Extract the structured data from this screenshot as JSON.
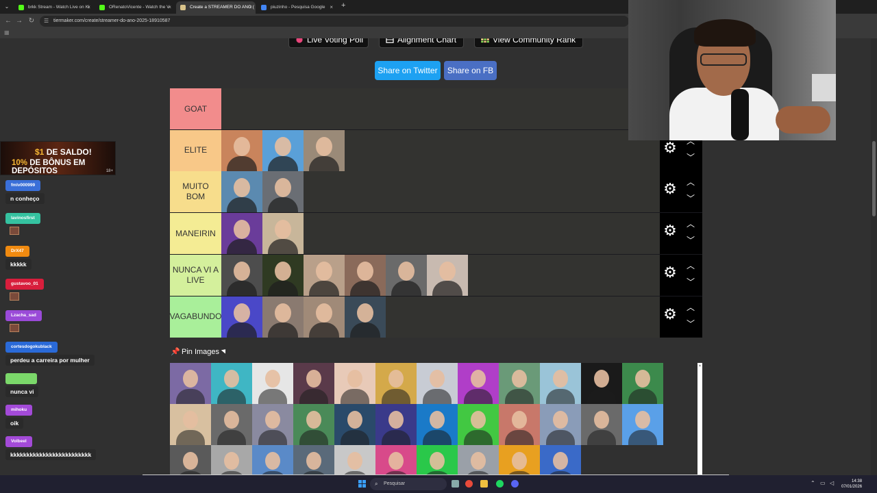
{
  "browser": {
    "tabs": [
      {
        "label": "brkk Stream - Watch Live on Ki",
        "icon_color": "#53fc18",
        "active": false
      },
      {
        "label": "ORenatoVicente - Watch the V",
        "icon_color": "#53fc18",
        "active": false
      },
      {
        "label": "Create a STREAMER DO ANO (",
        "icon_color": "#d9c38a",
        "active": true
      },
      {
        "label": "piuzinho - Pesquisa Google",
        "icon_color": "#4285f4",
        "active": false
      }
    ],
    "url": "tiermaker.com/create/streamer-do-ano-2025-18910587"
  },
  "toolbar": {
    "live_voting_label": "Live Voting Poll",
    "alignment_label": "Alignment Chart",
    "community_label": "View Community Rank",
    "share_twitter_label": "Share on Twitter",
    "share_fb_label": "Share on FB",
    "colors": {
      "twitter": "#1da1f2",
      "fb": "#4a6fc4"
    }
  },
  "tiers": [
    {
      "label": "GOAT",
      "color": "#f28c8c",
      "image_colors": []
    },
    {
      "label": "ELITE",
      "color": "#f8c888",
      "image_colors": [
        "#c9845c",
        "#5aa0d8",
        "#9a8a78"
      ]
    },
    {
      "label": "MUITO BOM",
      "color": "#f7dd8c",
      "image_colors": [
        "#5b8ab0",
        "#6a6e74"
      ]
    },
    {
      "label": "MANEIRIN",
      "color": "#f4ec94",
      "image_colors": [
        "#6a3c9a",
        "#c8b69a"
      ]
    },
    {
      "label": "NUNCA VI A LIVE",
      "color": "#d4f09c",
      "image_colors": [
        "#4d4d4d",
        "#2f3a22",
        "#b9a08a",
        "#8a6a5a",
        "#6a6a6a",
        "#c8bab0"
      ]
    },
    {
      "label": "VAGABUNDO",
      "color": "#a9ef9a",
      "image_colors": [
        "#4a48c8",
        "#8a7a70",
        "#a08a78",
        "#3a4a58"
      ]
    }
  ],
  "pin_label": "Pin Images",
  "pool_images": [
    "#7c6aa4",
    "#3fb6c4",
    "#e6e6e6",
    "#5a3a4a",
    "#e8cab8",
    "#d4a94a",
    "#c8ccd4",
    "#b03ec8",
    "#6a9a78",
    "#9ac4d8",
    "#1a1a1a",
    "#3c8a4c",
    "#d8c0a0",
    "#6a6a6a",
    "#8a8aa0",
    "#4a8a58",
    "#2a4a6a",
    "#3a3a8a",
    "#1a7ac8",
    "#42c842",
    "#c8786a",
    "#8a9cb8",
    "#6a6a6a",
    "#5aa0e8",
    "#5a5a5a",
    "#a8a8a8",
    "#5a8ac8",
    "#5a6a7a",
    "#c8c8c8",
    "#d84a8a",
    "#2ac84a",
    "#9aa0a8",
    "#e8a020",
    "#3a6ac8"
  ],
  "chat": {
    "ad_line1_highlight": "$1",
    "ad_line1_rest": " DE SALDO!",
    "ad_line2_highlight": "10%",
    "ad_line2_rest": " DE BÔNUS EM DEPÓSITOS",
    "ad_badge": "18+",
    "messages": [
      {
        "user": "fmlv000999",
        "color": "#3a6fd8",
        "text": "n conheço"
      },
      {
        "user": "lavinosfirst",
        "color": "#35c2a0",
        "text": ""
      },
      {
        "user": "DrX47",
        "color": "#f08a10",
        "text": "kkkkk"
      },
      {
        "user": "gustavoo_01",
        "color": "#d81e3c",
        "text": ""
      },
      {
        "user": "Lzacha_sad",
        "color": "#9a4ad8",
        "text": ""
      },
      {
        "user": "cortesdogokublack",
        "color": "#2a6ad8",
        "text": "perdeu a carreira por mulher"
      },
      {
        "user": "",
        "color": "#7bd86a",
        "text": "nunca vi"
      },
      {
        "user": "mihoku",
        "color": "#a34ad8",
        "text": "oik"
      },
      {
        "user": "Volbeel",
        "color": "#a34ad8",
        "text": "kkkkkkkkkkkkkkkkkkkkkkkkk"
      }
    ]
  },
  "taskbar": {
    "search_placeholder": "Pesquisar",
    "time": "14:38",
    "date": "07/01/2026"
  }
}
